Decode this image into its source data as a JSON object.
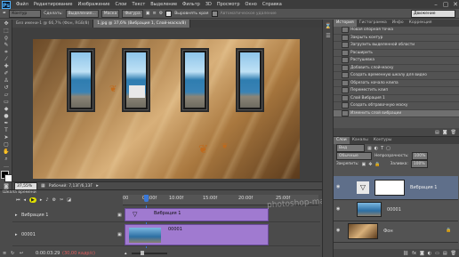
{
  "app": {
    "logo": "Ps"
  },
  "menu": [
    "Файл",
    "Редактирование",
    "Изображение",
    "Слои",
    "Текст",
    "Выделение",
    "Фильтр",
    "3D",
    "Просмотр",
    "Окно",
    "Справка"
  ],
  "window_controls": [
    "–",
    "▢",
    "✕"
  ],
  "options": {
    "tool_mode": "Контур",
    "make_label": "Сделать:",
    "selection_btn": "Выделение...",
    "mask_btn": "Маска",
    "shape_btn": "Фигура",
    "align_edges": "Выровнять края",
    "autoadd": "Автоматическое удаление",
    "workspace": "Движение"
  },
  "doc_tabs": [
    "Без имени-1 @ 66,7% (Фон, RGB/8)",
    "1.jpg @ 37,6% (Вибрация 1, Слой-маска/8)"
  ],
  "status": {
    "zoom": "37,55%",
    "doc": "Рабочий: 7,13Г/6,13Г"
  },
  "timeline": {
    "title": "Шкала времени",
    "ruler_labels": [
      "00",
      "05:00f",
      "10:00f",
      "15:00f",
      "20:00f",
      "25:00f"
    ],
    "tracks": [
      {
        "name": "Вибрация 1",
        "clip": "Вибрация 1"
      },
      {
        "name": "00001",
        "clip": "00001"
      }
    ],
    "timecode": "0:00:03:29",
    "fps": "(30,00 кадр/с)"
  },
  "history": {
    "tabs": [
      "История",
      "Гистограмма",
      "Инфо",
      "Коррекция"
    ],
    "items": [
      "Новая опорная точка",
      "Закрыть контур",
      "Загрузить выделенной области",
      "Расширить",
      "Растушевка",
      "Добавить слой-маску",
      "Создать временную шкалу для видео",
      "Обрезать начало клипа",
      "Переместить клип",
      "Слой Вибрация 1",
      "Создать обтравочную маску",
      "Изменить слой вибрации"
    ]
  },
  "layers": {
    "tabs": [
      "Слои",
      "Каналы",
      "Контуры"
    ],
    "filter": "Вид",
    "blend": "Обычные",
    "opacity_label": "Непрозрачность:",
    "opacity": "100%",
    "lock_label": "Закрепить:",
    "fill_label": "Заливка:",
    "fill": "100%",
    "items": [
      {
        "name": "Вибрация 1"
      },
      {
        "name": "00001"
      },
      {
        "name": "Фон"
      }
    ]
  },
  "watermark": "photoshop-master.ru"
}
